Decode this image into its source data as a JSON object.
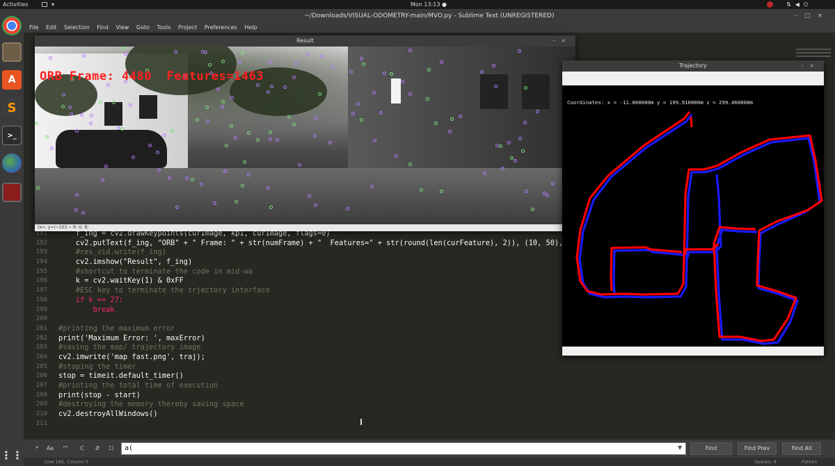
{
  "topbar": {
    "activities": "Activities",
    "clock": "Mon 13:13 ●"
  },
  "sublime": {
    "title": "~/Downloads/VISUAL-ODOMETRY-main/MVO.py - Sublime Text (UNREGISTERED)",
    "menu": [
      "File",
      "Edit",
      "Selection",
      "Find",
      "View",
      "Goto",
      "Tools",
      "Project",
      "Preferences",
      "Help"
    ],
    "code": [
      {
        "n": "191",
        "t": "    f_ing = cv2.drawKeypoints(curImage, kp1, curImage, flags=0)",
        "c": "sel"
      },
      {
        "n": "192",
        "t": "    cv2.putText(f_ing, \"ORB\" + \" Frame: \" + str(numFrame) + \"  Features=\" + str(round(len(curFeature), 2)), (10, 50), fo",
        "c": "sel"
      },
      {
        "n": "193",
        "t": "    #res_vid.write(f_ing)",
        "c": "cmt"
      },
      {
        "n": "194",
        "t": "    cv2.imshow(\"Result\", f_ing)",
        "c": "sel"
      },
      {
        "n": "195",
        "t": "    #shortcut to terminate the code in mid-wa",
        "c": "cmt"
      },
      {
        "n": "196",
        "t": "    k = cv2.waitKey(1) & 0xFF",
        "c": "sel"
      },
      {
        "n": "197",
        "t": "    #ESC key to terminate the trjectory interface",
        "c": "cmt"
      },
      {
        "n": "198",
        "t": "    if k == 27:",
        "c": "kw"
      },
      {
        "n": "199",
        "t": "        break",
        "c": "kw"
      },
      {
        "n": "200",
        "t": "",
        "c": "sel"
      },
      {
        "n": "201",
        "t": "#printing the maximum error",
        "c": "cmt"
      },
      {
        "n": "202",
        "t": "print('Maximum Error: ', maxError)",
        "c": "sel"
      },
      {
        "n": "203",
        "t": "#saving the map/ trajectory image",
        "c": "cmt"
      },
      {
        "n": "204",
        "t": "cv2.imwrite('map fast.png', traj);",
        "c": "sel"
      },
      {
        "n": "205",
        "t": "#stoping the timer",
        "c": "cmt"
      },
      {
        "n": "206",
        "t": "stop = timeit.default_timer()",
        "c": "sel"
      },
      {
        "n": "207",
        "t": "#printing the total time of execution",
        "c": "cmt"
      },
      {
        "n": "208",
        "t": "print(stop - start)",
        "c": "sel"
      },
      {
        "n": "209",
        "t": "#destroying the memory thereby saving space",
        "c": "cmt"
      },
      {
        "n": "210",
        "t": "cv2.destroyAllWindows()",
        "c": "sel"
      },
      {
        "n": "211",
        "t": "",
        "c": "sel"
      }
    ],
    "find": {
      "opt_regex": ".*",
      "opt_case": "Aa",
      "opt_word": "\"\"",
      "opt_wrap": "C",
      "opt_sel": "⇵",
      "opt_hl": "☐",
      "value": "a(",
      "find_btn": "Find",
      "find_prev_btn": "Find Prev",
      "find_all_btn": "Find All"
    },
    "status": {
      "left": "Line 185, Column 5",
      "spaces": "Spaces: 4",
      "syntax": "Python"
    }
  },
  "result_window": {
    "title": "Result",
    "overlay": "ORB Frame: 4480  Features=1463",
    "status": "(x=, y=)~103  ~  R:  G:  B:"
  },
  "trajectory_window": {
    "title": "Trajectory",
    "coordinates": "Coordinates: x = -11.000000m y = 199.910000m z = 299.460000m"
  },
  "colors": {
    "ground_truth": "#1a1aff",
    "estimated": "#ff0000",
    "overlay_text": "#ff2020"
  }
}
